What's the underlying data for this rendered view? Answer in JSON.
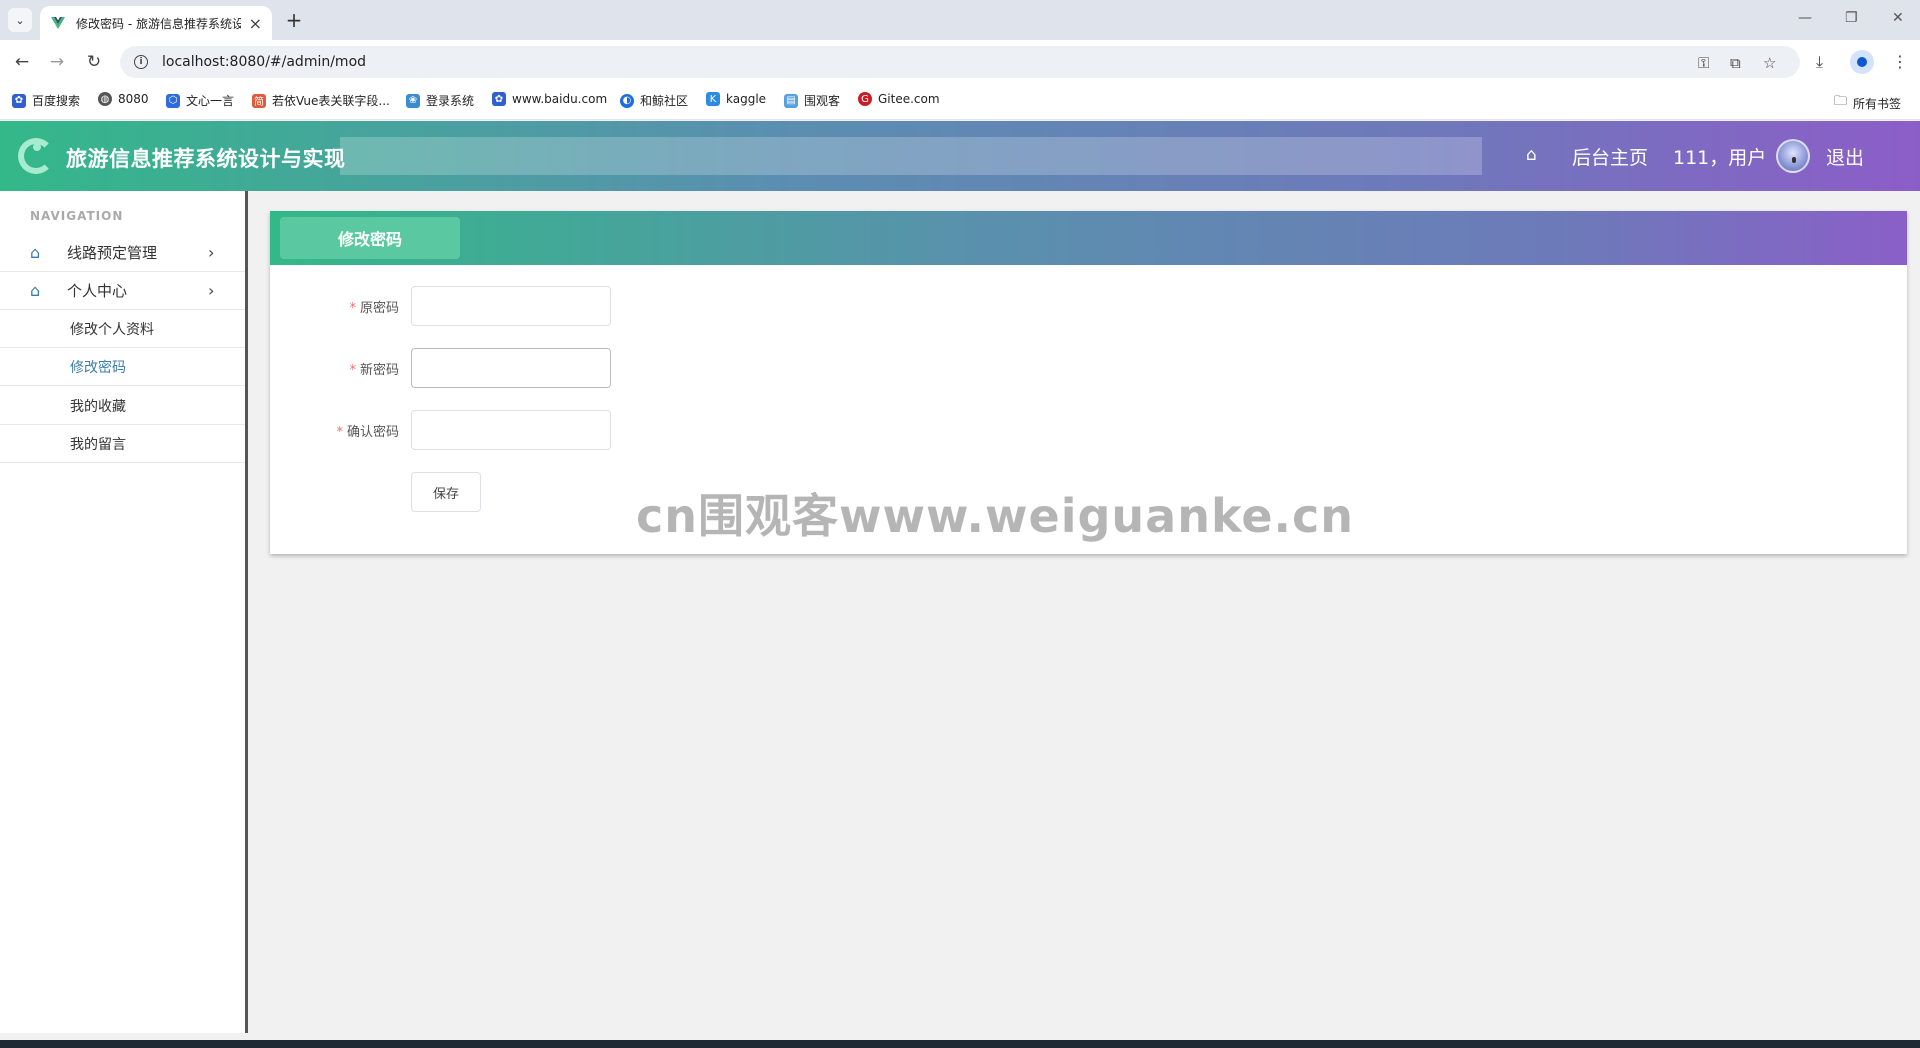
{
  "browser": {
    "tab_title": "修改密码 - 旅游信息推荐系统设",
    "url": "localhost:8080/#/admin/mod",
    "bookmarks": [
      {
        "label": "百度搜索",
        "color": "#3060d0"
      },
      {
        "label": "8080",
        "color": "#555555"
      },
      {
        "label": "文心一言",
        "color": "#2d6be0"
      },
      {
        "label": "若依Vue表关联字段...",
        "color": "#e05a3a"
      },
      {
        "label": "登录系统",
        "color": "#3a8bd0"
      },
      {
        "label": "www.baidu.com",
        "color": "#3060d0"
      },
      {
        "label": "和鲸社区",
        "color": "#1d6fe0"
      },
      {
        "label": "kaggle",
        "color": "#2d8be0"
      },
      {
        "label": "围观客",
        "color": "#5aa0e0"
      },
      {
        "label": "Gitee.com",
        "color": "#c71d23"
      }
    ],
    "all_bookmarks": "所有书签"
  },
  "header": {
    "title": "旅游信息推荐系统设计与实现",
    "home_link": "后台主页",
    "user_text": "111，用户",
    "logout": "退出"
  },
  "sidebar": {
    "heading": "NAVIGATION",
    "menus": [
      {
        "label": "线路预定管理"
      },
      {
        "label": "个人中心"
      }
    ],
    "submenu": [
      {
        "label": "修改个人资料",
        "active": false
      },
      {
        "label": "修改密码",
        "active": true
      },
      {
        "label": "我的收藏",
        "active": false
      },
      {
        "label": "我的留言",
        "active": false
      }
    ]
  },
  "panel": {
    "tab_label": "修改密码",
    "fields": [
      {
        "label": "原密码",
        "value": ""
      },
      {
        "label": "新密码",
        "value": ""
      },
      {
        "label": "确认密码",
        "value": ""
      }
    ],
    "required_mark": "*",
    "save_label": "保存"
  },
  "watermark": "cn围观客www.weiguanke.cn",
  "colors": {
    "accent_green": "#33b889",
    "accent_purple": "#8c5dc8",
    "active_menu": "#3b7ea8",
    "required": "#f56c6c"
  }
}
